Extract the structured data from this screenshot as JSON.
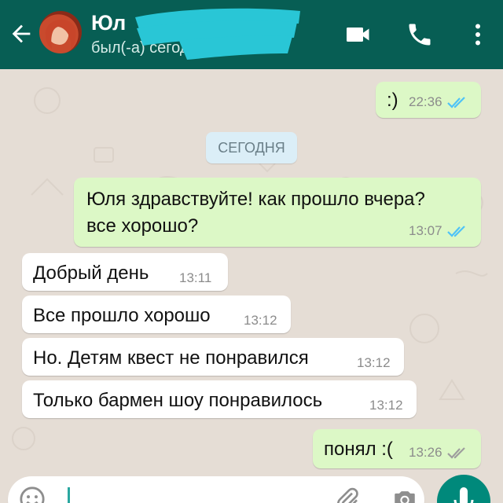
{
  "header": {
    "contact_name": "Юл",
    "status": "был(-а) сегодня"
  },
  "date_separator": "СЕГОДНЯ",
  "messages": [
    {
      "text": ":)",
      "time": "22:36",
      "direction": "out",
      "ticks": "read"
    },
    {
      "text_lines": [
        "Юля здравствуйте! как прошло вчера?",
        "все хорошо?"
      ],
      "time": "13:07",
      "direction": "out",
      "ticks": "read"
    },
    {
      "text": "Добрый день",
      "time": "13:11",
      "direction": "in"
    },
    {
      "text": "Все прошло хорошо",
      "time": "13:12",
      "direction": "in"
    },
    {
      "text": "Но. Детям квест не понравился",
      "time": "13:12",
      "direction": "in"
    },
    {
      "text": "Только бармен шоу понравилось",
      "time": "13:12",
      "direction": "in"
    },
    {
      "text": "понял :(",
      "time": "13:26",
      "direction": "out",
      "ticks": "delivered"
    }
  ],
  "colors": {
    "header": "#075e54",
    "outgoing_bubble": "#dcf8c6",
    "incoming_bubble": "#ffffff",
    "read_tick": "#4fc3f7",
    "delivered_tick": "#9e9e9e",
    "accent": "#00897b",
    "redaction": "#29c6d6"
  },
  "icons": [
    "back-arrow-icon",
    "video-call-icon",
    "phone-icon",
    "more-vert-icon",
    "emoji-icon",
    "attach-icon",
    "camera-icon",
    "mic-icon"
  ]
}
